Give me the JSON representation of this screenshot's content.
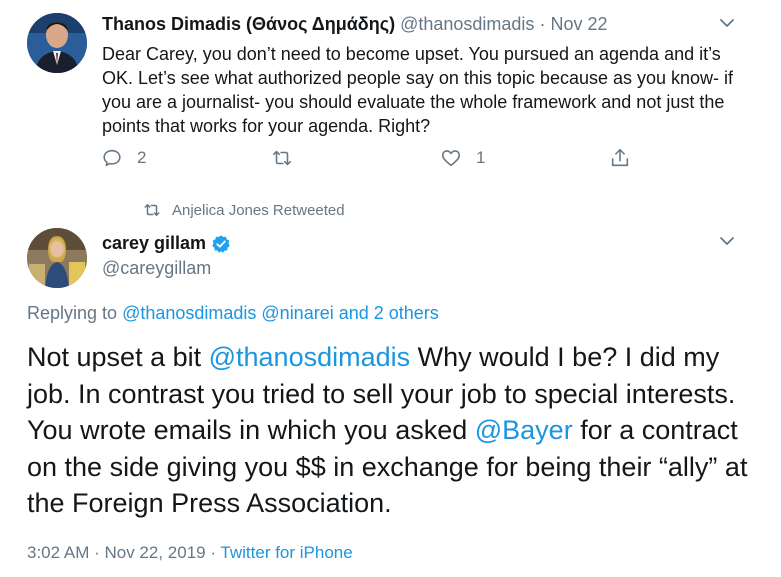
{
  "tweet1": {
    "author_name": "Thanos Dimadis (Θάνος Δημάδης)",
    "handle": "@thanosdimadis",
    "separator": "·",
    "date": "Nov 22",
    "text": "Dear Carey, you don’t need to become upset. You pursued an agenda and it’s OK. Let’s see what authorized people say on this topic because as you know- if you are a journalist- you should evaluate the whole framework and not just the points that works for your agenda. Right?",
    "reply_count": "2",
    "retweet_count": "",
    "like_count": "1",
    "icons": [
      "reply-icon",
      "retweet-icon",
      "like-icon",
      "share-icon",
      "chevron-down-icon"
    ]
  },
  "retweet_context": {
    "text": "Anjelica Jones Retweeted",
    "icon": "retweet-icon"
  },
  "tweet2": {
    "author_name": "carey gillam",
    "verified": true,
    "handle": "@careygillam",
    "replying_prefix": "Replying to ",
    "replying_to": "@thanosdimadis @ninarei and 2 others",
    "text_parts": {
      "p1": "Not upset a bit ",
      "m1": "@thanosdimadis",
      "p2": "  Why would I be? I did my job. In contrast you tried to sell your job to special interests. You wrote emails in which you asked ",
      "m2": "@Bayer",
      "p3": " for a contract on the side giving you $$ in exchange for being their “ally” at the Foreign Press Association."
    },
    "time": "3:02 AM · Nov 22, 2019",
    "time_sep": " · ",
    "source": "Twitter for iPhone"
  },
  "colors": {
    "text": "#14171a",
    "muted": "#657786",
    "link": "#1b95e0",
    "verified": "#1da1f2"
  }
}
